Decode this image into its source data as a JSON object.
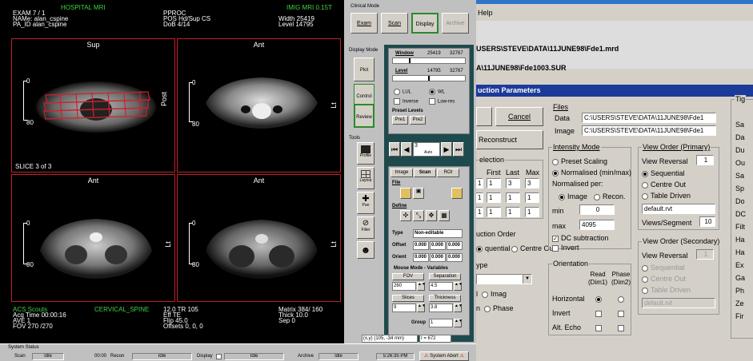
{
  "viewer": {
    "top_left": [
      "HOSPITAL MRI",
      "EXAM  7  / 1",
      "NAMe: alan_cspine",
      "PA_ID alan_cspine"
    ],
    "top_mid": [
      "PPROC",
      "POS    Hd/Sup  CS",
      "DoB     4/14"
    ],
    "top_right": [
      "IMIG MRI 0.15T",
      "Width  25419",
      "Level   14795"
    ],
    "viewports": [
      {
        "label": "Sup",
        "side": "Post",
        "r0": "0",
        "r1": "80"
      },
      {
        "label": "Ant",
        "side": "Lt",
        "r0": "0",
        "r1": "80"
      },
      {
        "label": "Ant",
        "side": "Lt",
        "r0": "0",
        "r1": "80"
      },
      {
        "label": "Ant",
        "side": "Lt",
        "r0": "0",
        "r1": "80"
      }
    ],
    "slice_text": "SLICE 3   of 3",
    "bottom_left": [
      "ACS Scouts",
      "Acq Time  00:00:16",
      "AVE   1",
      "FOV   270 /270"
    ],
    "bottom_mid1": [
      "CERVICAL_SPINE"
    ],
    "bottom_mid2": [
      "12.0     TR      105",
      "Eff TE",
      "Flip       45.0",
      "Offsets   0, 0, 0"
    ],
    "bottom_right": [
      "Matrix  384/ 160",
      "",
      "Thick   10.0",
      "Sep      0"
    ]
  },
  "controls": {
    "clinical_mode": "Clinical Mode",
    "top_buttons": [
      "Exam",
      "Scan",
      "Display",
      "Archive"
    ],
    "display_mode": "Display Mode",
    "display_buttons": [
      "Plot",
      "Control",
      "Review"
    ],
    "tools": "Tools",
    "tool_buttons": [
      "Profile",
      "Layout",
      "Pan",
      "Filter",
      ""
    ],
    "window_label": "Window",
    "window_val": "25419",
    "window_max": "32767",
    "level_label": "Level",
    "level_val": "14795",
    "level_max": "32767",
    "lut_options": [
      "LUL",
      "WL"
    ],
    "checks": [
      "Inverse",
      "Low-res"
    ],
    "preset_label": "Preset Levels",
    "presets": [
      "Pre1",
      "Pre2"
    ],
    "frame": "3",
    "frame_sub": "Auto",
    "tabs": [
      "Image",
      "Scan",
      "ROI"
    ],
    "file": "File",
    "define": "Define",
    "type_label": "Type",
    "type_val": "Non-editable",
    "offset_label": "Offset",
    "offset_vals": [
      "0.000",
      "0.000",
      "0.000"
    ],
    "orient_label": "Orient",
    "orient_vals": [
      "0.000",
      "0.000",
      "0.000"
    ],
    "mouse_mode": "Mouse Mode - Variables",
    "var_heads": [
      "FOV",
      "Separation",
      "Slices",
      "Thickness"
    ],
    "var_vals": [
      "260",
      "4.5",
      "9",
      "3.8"
    ],
    "group_label": "Group",
    "group_val": "1",
    "coord": "(x,y)   (105, -34 mm)",
    "intensity": "I = 672"
  },
  "status": {
    "title": "System Status",
    "items": [
      {
        "label": "Scan",
        "value": "Idle"
      },
      {
        "label": "00:00",
        "value": ""
      },
      {
        "label": "Recon",
        "value": "Idle"
      },
      {
        "label": "Display",
        "value": "Idle"
      },
      {
        "label": "Archive",
        "value": "Idle"
      }
    ],
    "time": "5:26:35 PM",
    "abort": "System Abort"
  },
  "dialog": {
    "menu": "Help",
    "path1": "USERS\\STEVE\\DATA\\11JUNE98\\Fde1.mrd",
    "path2": "A\\11JUNE98\\Fde1003.SUR",
    "title": "uction Parameters",
    "cancel": "Cancel",
    "reconstruct": "Reconstruct",
    "files_label": "Files",
    "data_label": "Data",
    "data_val": "C:\\USERS\\STEVE\\DATA\\11JUNE98\\Fde1",
    "image_label": "Image",
    "image_val": "C:\\USERS\\STEVE\\DATA\\11JUNE98\\Fde1",
    "selection": "election",
    "sel_heads": [
      "First",
      "Last",
      "Max"
    ],
    "sel_rows": [
      [
        "1",
        "3",
        "3"
      ],
      [
        "1",
        "1",
        "1"
      ],
      [
        "1",
        "1",
        "1"
      ]
    ],
    "sel_left": [
      "1",
      "1",
      "1"
    ],
    "recon_order": "uction Order",
    "recon_order_opts": [
      "quential",
      "Centre Out"
    ],
    "type": "ype",
    "type_opts": [
      "Imag",
      "Phase"
    ],
    "type_prefix": [
      "l",
      "n"
    ],
    "intensity": "Intensity Mode",
    "int_opts": [
      "Preset Scaling",
      "Normalised (min/max)"
    ],
    "normalised_per": "Normalised per:",
    "per_opts": [
      "Image",
      "Recon."
    ],
    "min_label": "min",
    "min_val": "0",
    "max_label": "max",
    "max_val": "4095",
    "dc_sub": "DC subtraction",
    "invert": "Invert",
    "orientation": "Orientation",
    "read_head": "Read (Dim1)",
    "phase_head": "Phase (Dim2)",
    "orient_rows": [
      "Horizontal",
      "Invert",
      "Alt. Echo"
    ],
    "view_order": "View Order (Primary)",
    "view_reversal": "View Reversal",
    "view_rev_val": "1",
    "vo_opts": [
      "Sequential",
      "Centre Out",
      "Table Driven"
    ],
    "vo_file": "default.rvt",
    "views_seg": "Views/Segment",
    "views_seg_val": "10",
    "view_order2": "View Order (Secondary)",
    "view_rev2_val": "1",
    "vo2_opts": [
      "Sequential",
      "Centre Out",
      "Table Driven"
    ],
    "vo2_file": "default.rvt",
    "right_col": [
      "Tig",
      "Sa",
      "Da",
      "Du",
      "Ou",
      "Sa",
      "Sp",
      "Do",
      "DC",
      "Filt",
      "Ha",
      "Ha",
      "Ex",
      "Ga",
      "Ph",
      "Ze",
      "Fir"
    ]
  }
}
